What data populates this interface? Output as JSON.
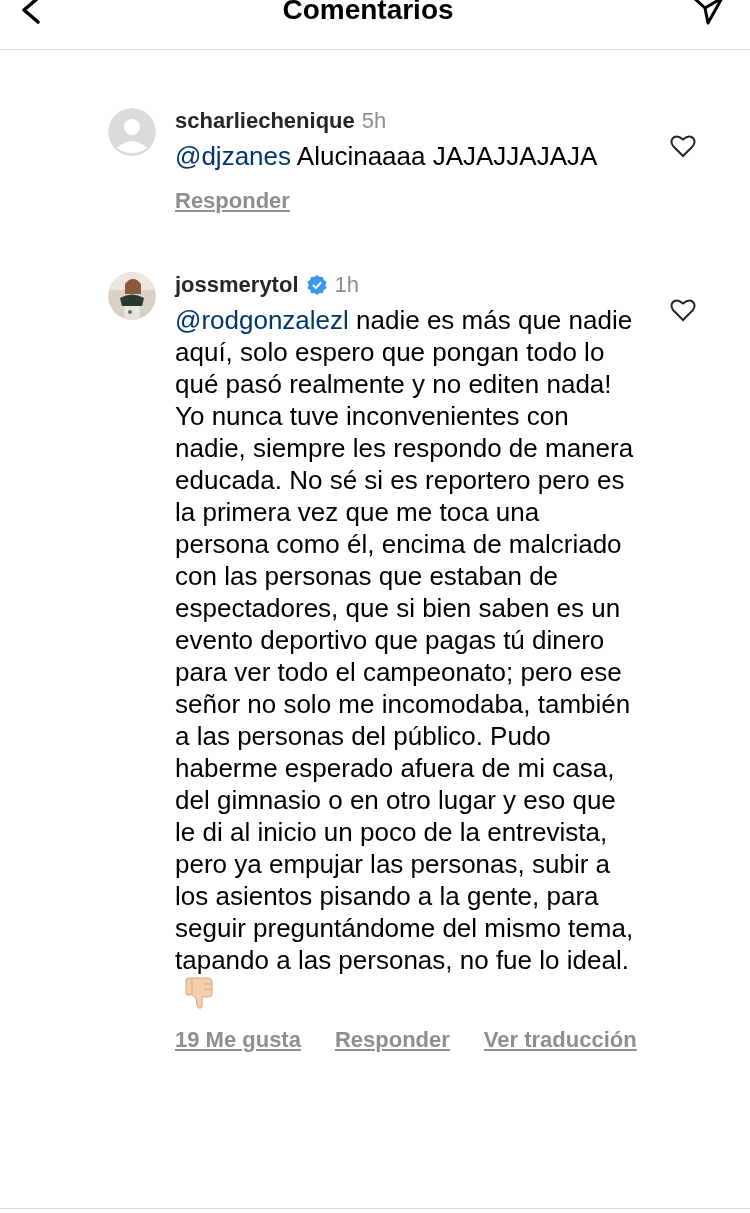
{
  "header": {
    "title": "Comentarios"
  },
  "comments": [
    {
      "avatar": {
        "kind": "default"
      },
      "username": "scharliechenique",
      "verified": false,
      "time": "5h",
      "mention": "@djzanes",
      "text": "Alucinaaaa JAJAJJAJAJA",
      "emoji": false,
      "actions": [
        "Responder"
      ]
    },
    {
      "username": "jossmerytol",
      "verified": true,
      "time": "1h",
      "mention": "@rodgonzalezl",
      "text": "nadie es más que nadie aquí, solo espero que pongan todo lo qué pasó realmente y no editen nada! Yo nunca tuve inconvenientes con nadie, siempre les respondo de manera educada. No sé si es reportero pero es la primera vez que me toca una persona como él, encima de malcriado con las personas que estaban de espectadores, que si bien saben es un evento deportivo que pagas tú dinero para ver todo el campeonato; pero ese señor no solo me incomodaba, también a las personas del público. Pudo haberme esperado afuera de mi casa, del gimnasio o en otro lugar y eso que le di al inicio un poco de la entrevista, pero ya empujar las personas, subir a los asientos pisando a la gente, para seguir preguntándome del mismo tema, tapando a las personas, no fue lo ideal.",
      "emoji": true,
      "actions": [
        "19 Me gusta",
        "Responder",
        "Ver traducción"
      ]
    }
  ]
}
